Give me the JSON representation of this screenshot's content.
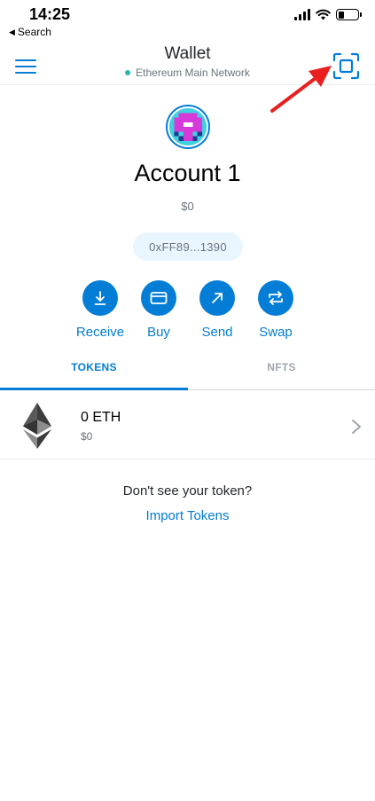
{
  "status_bar": {
    "time": "14:25",
    "back_label": "Search",
    "back_icon": "back-triangle-icon"
  },
  "header": {
    "title": "Wallet",
    "network": "Ethereum Main Network",
    "menu_icon": "hamburger-menu-icon",
    "scan_icon": "qr-scan-icon"
  },
  "account": {
    "name": "Account 1",
    "balance": "$0",
    "address": "0xFF89...1390"
  },
  "actions": [
    {
      "label": "Receive",
      "icon": "download-icon"
    },
    {
      "label": "Buy",
      "icon": "card-icon"
    },
    {
      "label": "Send",
      "icon": "arrow-up-right-icon"
    },
    {
      "label": "Swap",
      "icon": "swap-icon"
    }
  ],
  "tabs": [
    {
      "label": "TOKENS",
      "active": true
    },
    {
      "label": "NFTS",
      "active": false
    }
  ],
  "tokens": [
    {
      "amount": "0 ETH",
      "fiat": "$0",
      "icon": "ethereum-icon"
    }
  ],
  "import": {
    "prompt": "Don't see your token?",
    "link": "Import Tokens"
  },
  "colors": {
    "accent": "#037dd6",
    "network_dot": "#29b6af",
    "annotation_arrow": "#e8201f"
  }
}
